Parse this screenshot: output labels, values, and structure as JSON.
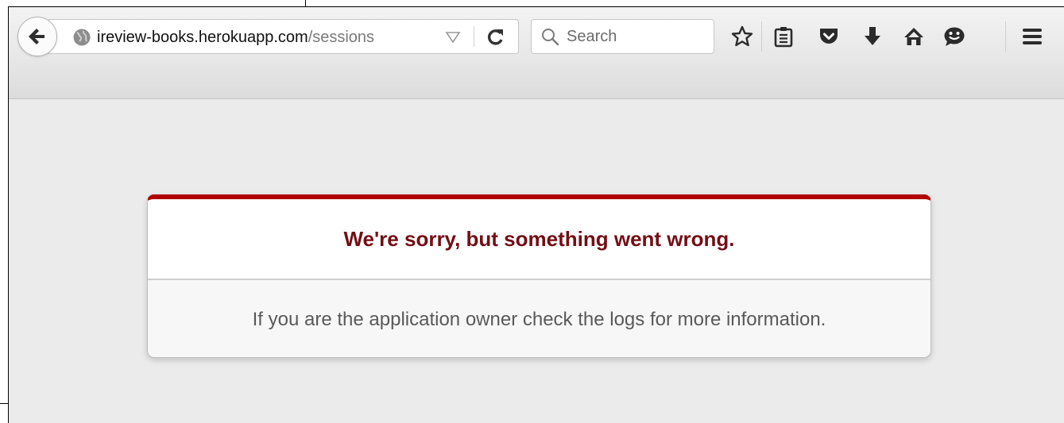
{
  "browser": {
    "url": {
      "host": "ireview-books.herokuapp.com",
      "path": "/sessions"
    },
    "search": {
      "placeholder": "Search"
    },
    "toolbar_icons": [
      "back-icon",
      "globe-icon",
      "dropdown-icon",
      "reload-icon",
      "search-icon",
      "star-icon",
      "reading-list-icon",
      "pocket-icon",
      "download-icon",
      "home-icon",
      "chat-icon",
      "menu-icon"
    ]
  },
  "error_page": {
    "heading": "We're sorry, but something went wrong.",
    "message": "If you are the application owner check the logs for more information."
  },
  "colors": {
    "accent_red": "#b00100",
    "heading_text": "#730e15",
    "page_background": "#ebebeb"
  }
}
